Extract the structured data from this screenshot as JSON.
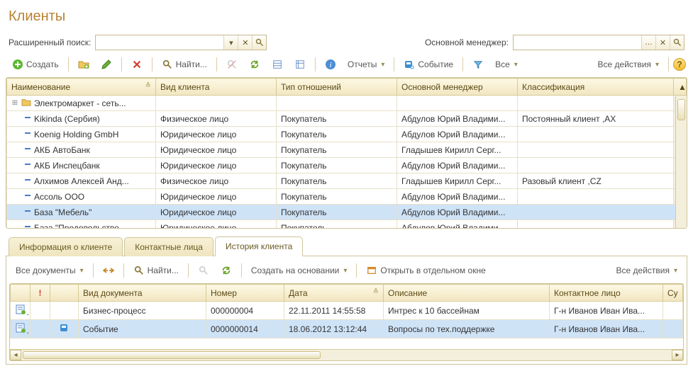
{
  "title": "Клиенты",
  "search": {
    "ext_label": "Расширенный поиск:",
    "ext_value": "",
    "manager_label": "Основной менеджер:",
    "manager_value": ""
  },
  "toolbar": {
    "create": "Создать",
    "find": "Найти...",
    "reports": "Отчеты",
    "event": "Событие",
    "all": "Все",
    "all_actions": "Все действия"
  },
  "grid": {
    "columns": {
      "name": "Наименование",
      "type": "Вид клиента",
      "relation": "Тип отношений",
      "manager": "Основной менеджер",
      "class": "Классификация"
    },
    "rows": [
      {
        "tree": "folder",
        "name": "Электромаркет - сеть...",
        "type": "",
        "relation": "",
        "manager": "",
        "class": ""
      },
      {
        "tree": "leaf",
        "name": "Kikinda (Сербия)",
        "type": "Физическое лицо",
        "relation": "Покупатель",
        "manager": "Абдулов Юрий Владими...",
        "class": "Постоянный клиент ,AX"
      },
      {
        "tree": "leaf",
        "name": "Koenig Holding GmbH",
        "type": "Юридическое лицо",
        "relation": "Покупатель",
        "manager": "Абдулов Юрий Владими...",
        "class": ""
      },
      {
        "tree": "leaf",
        "name": "АКБ АвтоБанк",
        "type": "Юридическое лицо",
        "relation": "Покупатель",
        "manager": "Гладышев Кирилл Серг...",
        "class": ""
      },
      {
        "tree": "leaf",
        "name": "АКБ Инспецбанк",
        "type": "Юридическое лицо",
        "relation": "Покупатель",
        "manager": "Абдулов Юрий Владими...",
        "class": ""
      },
      {
        "tree": "leaf",
        "name": "Алхимов Алексей Анд...",
        "type": "Физическое лицо",
        "relation": "Покупатель",
        "manager": "Гладышев Кирилл Серг...",
        "class": "Разовый клиент ,CZ"
      },
      {
        "tree": "leaf",
        "name": "Ассоль ООО",
        "type": "Юридическое лицо",
        "relation": "Покупатель",
        "manager": "Абдулов Юрий Владими...",
        "class": ""
      },
      {
        "tree": "leaf",
        "name": "База \"Мебель\"",
        "type": "Юридическое лицо",
        "relation": "Покупатель",
        "manager": "Абдулов Юрий Владими...",
        "class": "",
        "selected": true
      },
      {
        "tree": "leaf",
        "name": "База \"Продовольстве...",
        "type": "Юридическое лицо",
        "relation": "Покупатель",
        "manager": "Абдулов Юрий Владими...",
        "class": ""
      }
    ]
  },
  "tabs": {
    "info": "Информация о клиенте",
    "contacts": "Контактные лица",
    "history": "История клиента"
  },
  "sub_toolbar": {
    "all_docs": "Все документы",
    "find": "Найти...",
    "create_based": "Создать на основании",
    "open_window": "Открыть в отдельном окне",
    "all_actions": "Все действия"
  },
  "sub_grid": {
    "columns": {
      "flag": "!",
      "doc_type": "Вид документа",
      "number": "Номер",
      "date": "Дата",
      "desc": "Описание",
      "contact": "Контактное лицо",
      "su": "Су"
    },
    "rows": [
      {
        "doc_type": "Бизнес-процесс",
        "number": "000000004",
        "date": "22.11.2011 14:55:58",
        "desc": "Интрес к 10 бассейнам",
        "contact": "Г-н Иванов Иван Ива..."
      },
      {
        "doc_type": "Событие",
        "number": "0000000014",
        "date": "18.06.2012 13:12:44",
        "desc": "Вопросы по тех.поддержке",
        "contact": "Г-н Иванов Иван Ива...",
        "selected": true,
        "event_icon": true
      }
    ]
  }
}
